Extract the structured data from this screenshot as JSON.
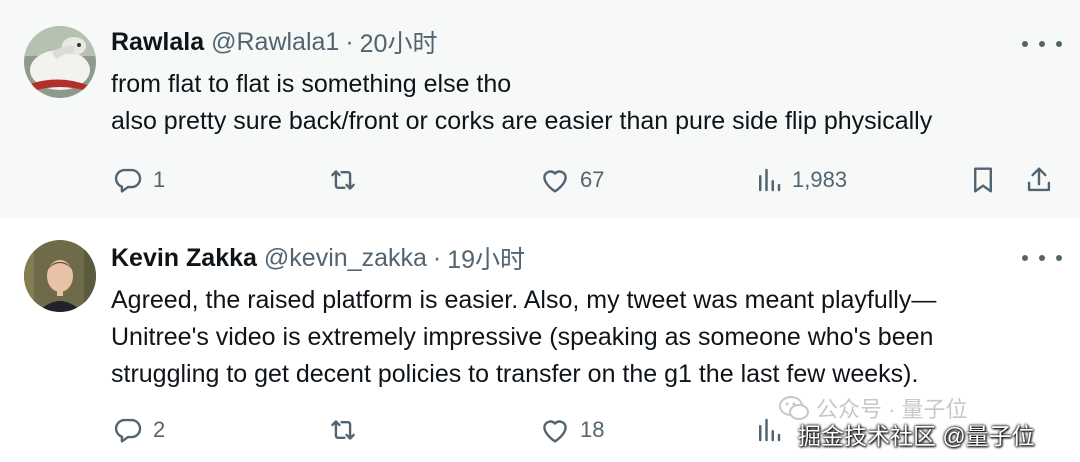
{
  "replies": [
    {
      "author": {
        "name": "Rawlala",
        "handle": "@Rawlala1",
        "time": "20小时"
      },
      "text_lines": [
        "from flat to flat is something else tho",
        "also pretty sure back/front or corks are easier than pure side flip physically"
      ],
      "stats": {
        "replies": "1",
        "likes": "67",
        "views": "1,983"
      }
    },
    {
      "author": {
        "name": "Kevin Zakka",
        "handle": "@kevin_zakka",
        "time": "19小时"
      },
      "text_lines": [
        "Agreed, the raised platform is easier. Also, my tweet was meant playfully—",
        "Unitree's video is extremely impressive (speaking as someone who's been",
        "struggling to get decent policies to transfer on the g1 the last few weeks)."
      ],
      "stats": {
        "replies": "2",
        "likes": "18"
      }
    }
  ],
  "separator": "·",
  "watermark": {
    "text": "公众号 · 量子位"
  },
  "source_tag": {
    "text": "掘金技术社区 @量子位"
  },
  "icons": {
    "reply": "reply-icon",
    "retweet": "retweet-icon",
    "like": "like-icon",
    "views": "views-icon",
    "bookmark": "bookmark-icon",
    "share": "share-icon",
    "more": "more-icon"
  },
  "colors": {
    "text": "#0f1419",
    "secondary": "#536471",
    "thread_line": "#cfd9de",
    "highlight_bg": "#f7f9f9"
  }
}
